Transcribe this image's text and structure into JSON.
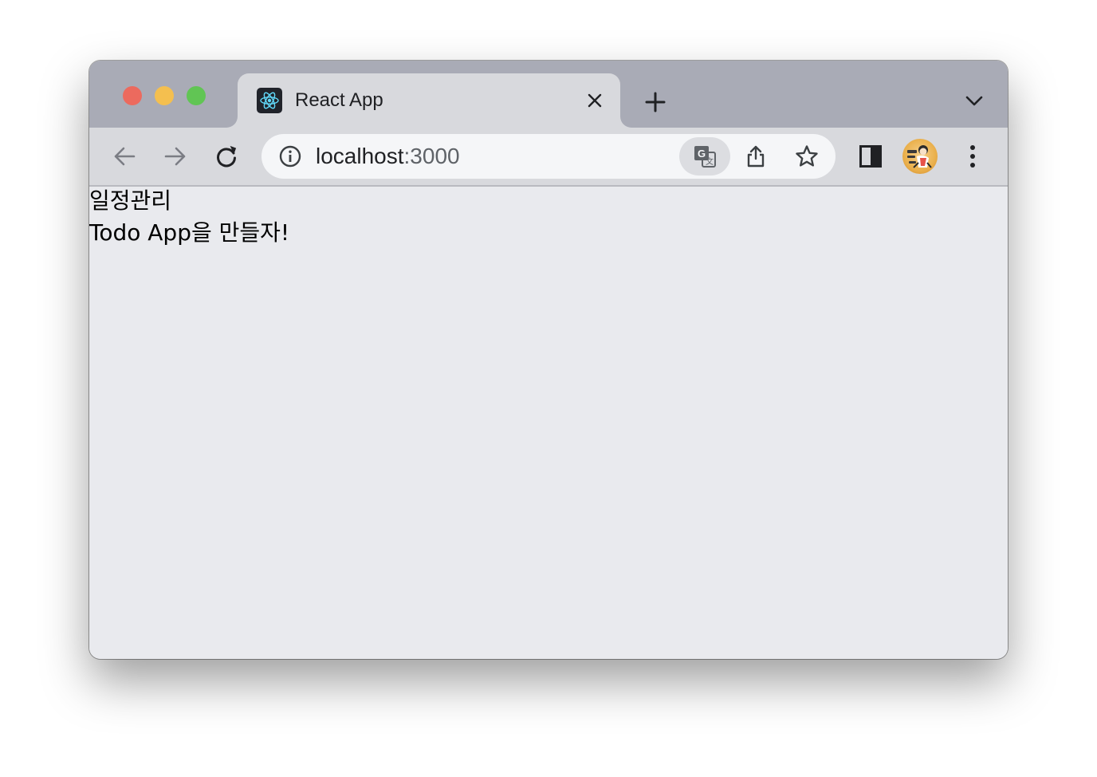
{
  "browser": {
    "tab": {
      "title": "React App",
      "favicon": "react-logo-icon"
    },
    "controls": {
      "close_tab_icon": "close-icon",
      "new_tab_icon": "plus-icon",
      "tab_search_icon": "chevron-down-icon"
    },
    "toolbar": {
      "back_icon": "arrow-left-icon",
      "forward_icon": "arrow-right-icon",
      "reload_icon": "reload-icon",
      "site_info_icon": "info-icon",
      "url_host": "localhost",
      "url_port": ":3000",
      "translate_icon": "translate-icon",
      "share_icon": "share-icon",
      "bookmark_icon": "star-icon",
      "side_panel_icon": "side-panel-icon",
      "profile_icon": "avatar",
      "menu_icon": "kebab-menu-icon"
    },
    "colors": {
      "tabstrip": "#a9abb6",
      "active_tab": "#d8d9dd",
      "page_background": "#e9eaee",
      "close_red": "#ec6a5e",
      "minimize_yellow": "#f4bf4f",
      "zoom_green": "#61c554",
      "react_cyan": "#61dafb"
    }
  },
  "page": {
    "heading": "일정관리",
    "subtitle": "Todo App을 만들자!"
  }
}
